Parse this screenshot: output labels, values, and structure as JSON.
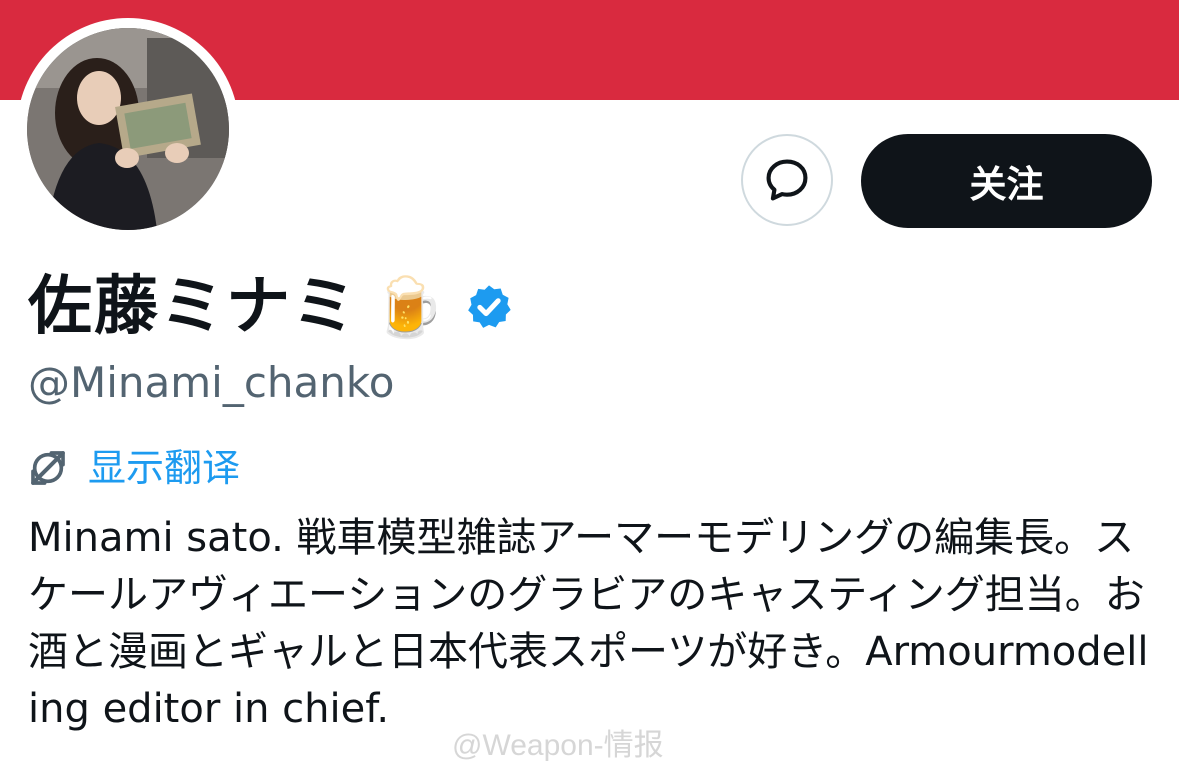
{
  "profile": {
    "display_name": "佐藤ミナミ",
    "name_emoji": "🍺",
    "verified": true,
    "handle": "@Minami_chanko",
    "banner_color": "#d92a3f"
  },
  "actions": {
    "message_icon": "chat-bubble-icon",
    "follow_label": "关注"
  },
  "translate": {
    "icon": "translate-icon",
    "label": "显示翻译",
    "color": "#1d9bf0"
  },
  "bio": "Minami sato. 戦車模型雑誌アーマーモデリングの編集長。スケールアヴィエーションのグラビアのキャスティング担当。お酒と漫画とギャルと日本代表スポーツが好き。Armourmodelling editor in chief.",
  "watermark": "@Weapon-情报"
}
